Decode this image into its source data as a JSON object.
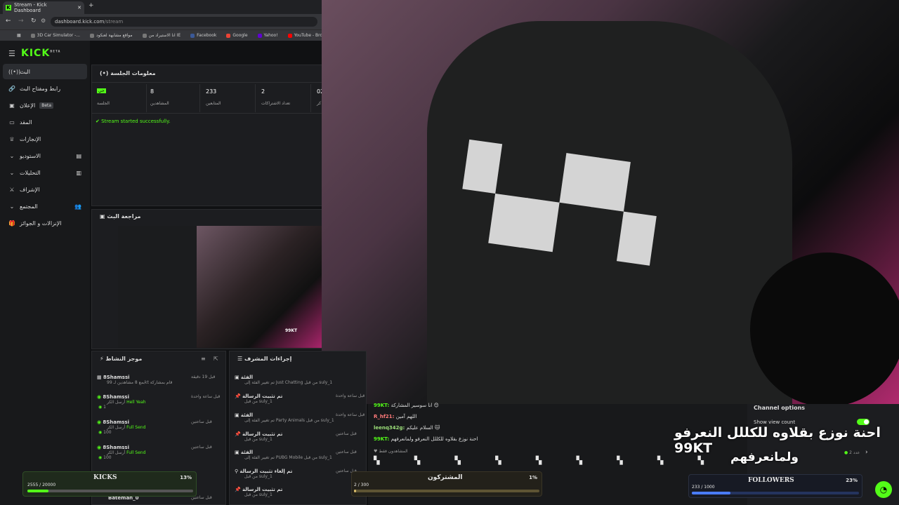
{
  "browser": {
    "tab_title": "Stream - Kick Dashboard",
    "url_domain": "dashboard.kick.com",
    "url_path": "/stream",
    "bookmarks": [
      "3D Car Simulator -...",
      "مواقع مشابهة لعنكود",
      "انا الاستيراد من IE",
      "Facebook",
      "Google",
      "Yahoo!",
      "YouTube - Broadcas..."
    ]
  },
  "sidebar": {
    "logo": "KICK",
    "logo_beta": "BETA",
    "items": [
      {
        "label": "البث",
        "icon": "broadcast-icon"
      },
      {
        "label": "رابط ومفتاح البث",
        "icon": "link-icon"
      },
      {
        "label": "الإعلان",
        "badge": "Beta",
        "icon": "ad-icon"
      },
      {
        "label": "المقد",
        "icon": "wallet-icon"
      },
      {
        "label": "الإنجازات",
        "icon": "trophy-icon"
      },
      {
        "label": "الاستوديو",
        "icon": "studio-icon"
      },
      {
        "label": "التحليلات",
        "icon": "chart-icon"
      },
      {
        "label": "الإشراف",
        "icon": "shield-icon"
      },
      {
        "label": "المجتمع",
        "icon": "people-icon"
      },
      {
        "label": "الإنزالات و الجوائز",
        "icon": "gift-icon"
      }
    ]
  },
  "session": {
    "title": "معلومات الجلسة",
    "live_badge": "حي",
    "stats": [
      {
        "value": "",
        "label": "الجلسة"
      },
      {
        "value": "8",
        "label": "المشاهدين"
      },
      {
        "value": "233",
        "label": "المتابعين"
      },
      {
        "value": "2",
        "label": "تعداد الاشتراكات"
      },
      {
        "value": "02",
        "label": "كر"
      }
    ],
    "status": "Stream started successfully."
  },
  "preview": {
    "title": "مراجعة البث",
    "overlay_name": "99KT"
  },
  "activity": {
    "title": "موجز النشاط",
    "items": [
      {
        "user": "8Shamssi",
        "desc": "بمع 8 مشاهدين لـ 99kt قام بمشاركة",
        "time": "قبل 19 دقيقة",
        "amount": ""
      },
      {
        "user": "8Shamssi",
        "desc": "أرسل الكر",
        "item": "Hell Yeah",
        "time": "قبل ساعة واحدة",
        "amount": "1"
      },
      {
        "user": "8Shamssi",
        "desc": "أرسل الكر",
        "item": "Full Send",
        "time": "قبل ساعتين",
        "amount": "100"
      },
      {
        "user": "8Shamssi",
        "desc": "أرسل الكر",
        "item": "Full Send",
        "time": "قبل ساعتين",
        "amount": "100"
      },
      {
        "user": "Bateman_0",
        "desc": "",
        "item": "",
        "time": "قبل ساعتين",
        "amount": ""
      }
    ]
  },
  "modactions": {
    "title": "إجراءات المشرف",
    "items": [
      {
        "action": "الفئة",
        "detail": "تم تغيير الفئة إلى Just Chatting من قبل suly_1",
        "time": ""
      },
      {
        "action": "تم تثبيت الرسالة",
        "detail": "من قبل suly_1",
        "time": "قبل ساعة واحدة"
      },
      {
        "action": "الفئة",
        "detail": "تم تغيير الفئة إلى Party Animals من قبل suly_1",
        "time": "قبل ساعة واحدة"
      },
      {
        "action": "تم تثبيت الرسالة",
        "detail": "من قبل suly_1",
        "time": "قبل ساعتين"
      },
      {
        "action": "الفئة",
        "detail": "تم تغيير الفئة إلى PUBG Mobile من قبل suly_1",
        "time": "قبل ساعتين"
      },
      {
        "action": "تم إلغاء تثبيت الرسالة",
        "detail": "من قبل suly_1",
        "time": "قبل ساعتين"
      },
      {
        "action": "تم تثبيت الرسالة",
        "detail": "من قبل suly_1",
        "time": "قبل ساعتين"
      }
    ]
  },
  "chat": {
    "messages": [
      {
        "user": "99KT:",
        "text": "انا سوسير المشاركة 😊"
      },
      {
        "user": "R_hf21:",
        "text": "اللهم آمين"
      },
      {
        "user": "leenq342g:",
        "text": "السلام عليكم"
      },
      {
        "user": "99KT:",
        "text": "احنة نوزع بقلاوه للكللل النعرفو ولمانعرفهم"
      }
    ],
    "viewers_label": "المشاهدون فقط"
  },
  "channel_options": {
    "title": "Channel options",
    "show_view_count": "Show view count",
    "small_label": "عدد 2"
  },
  "overlay": {
    "line1": "احنة نوزع بقلاوه للكللل النعرفو  99KT",
    "line2": "ولمانعرفهم"
  },
  "goals": {
    "kicks": {
      "label": "KICKS",
      "percent_text": "13%",
      "progress_text": "2555 / 20000",
      "fraction": 0.128,
      "color": "#53fc18"
    },
    "subs": {
      "label": "المشتركون",
      "percent_text": "1%",
      "progress_text": "2 / 300",
      "fraction": 0.01,
      "color": "#d6b96a"
    },
    "followers": {
      "label": "FOLLOWERS",
      "percent_text": "23%",
      "progress_text": "233 / 1000",
      "fraction": 0.233,
      "color": "#4a7cff"
    }
  }
}
